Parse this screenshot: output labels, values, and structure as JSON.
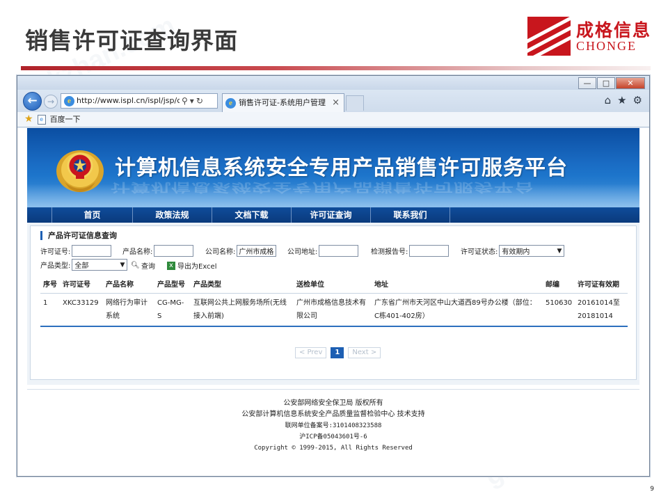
{
  "slide": {
    "title": "销售许可证查询界面",
    "page_number": "9",
    "brand": {
      "cn": "成格信息",
      "en": "CHONGE"
    },
    "watermark": "gkzhan.com"
  },
  "browser": {
    "address": "http://www.ispl.cn/ispl/jsp/co",
    "tab_title": "销售许可证-系统用户管理",
    "favorite": "百度一下",
    "window_controls": [
      "—",
      "□",
      "✕"
    ]
  },
  "site": {
    "banner_title": "计算机信息系统安全专用产品销售许可服务平台",
    "nav": [
      "首页",
      "政策法规",
      "文档下载",
      "许可证查询",
      "联系我们"
    ]
  },
  "query": {
    "panel_title": "产品许可证信息查询",
    "fields": {
      "license_no": {
        "label": "许可证号:",
        "value": ""
      },
      "product_name": {
        "label": "产品名称:",
        "value": ""
      },
      "company_name": {
        "label": "公司名称:",
        "value": "广州市成格"
      },
      "company_address": {
        "label": "公司地址:",
        "value": ""
      },
      "report_no": {
        "label": "检测报告号:",
        "value": ""
      },
      "license_status": {
        "label": "许可证状态:",
        "value": "有效期内"
      },
      "product_type": {
        "label": "产品类型:",
        "value": "全部"
      }
    },
    "search_label": "查询",
    "export_label": "导出为Excel"
  },
  "results": {
    "headers": [
      "序号",
      "许可证号",
      "产品名称",
      "产品型号",
      "产品类型",
      "送检单位",
      "地址",
      "邮编",
      "许可证有效期"
    ],
    "rows": [
      [
        "1",
        "XKC33129",
        "网络行为审计系统",
        "CG-MG-S",
        "互联网公共上网服务场所(无线接入前端)",
        "广州市成格信息技术有限公司",
        "广东省广州市天河区中山大道西89号办公楼（部位：C栋401-402房）",
        "510630",
        "20161014至20181014"
      ]
    ]
  },
  "pager": {
    "prev": "< Prev",
    "current": "1",
    "next": "Next >"
  },
  "footer": {
    "line1": "公安部网络安全保卫局 版权所有",
    "line2": "公安部计算机信息系统安全产品质量监督检验中心 技术支持",
    "line3": "联网单位备案号:3101408323588",
    "line4": "沪ICP备05043601号-6",
    "line5": "Copyright © 1999-2015, All Rights Reserved"
  }
}
